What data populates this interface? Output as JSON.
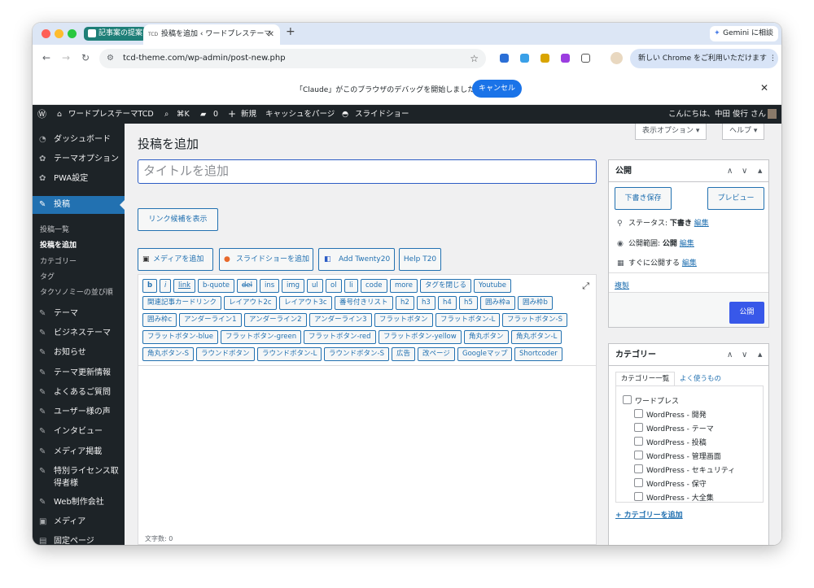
{
  "browser": {
    "tab_group_label": "記事案の提案",
    "active_tab_favicon": "TCD",
    "active_tab_title": "投稿を追加 ‹ ワードプレステーマ",
    "new_tab": "+",
    "gemini_label": "Gemini に相談",
    "url": "tcd-theme.com/wp-admin/post-new.php",
    "chrome_update": "新しい Chrome をご利用いただけます ⋮",
    "debug_message": "「Claude」がこのブラウザのデバッグを開始しました",
    "debug_cancel": "キャンセル",
    "close": "✕"
  },
  "adminbar": {
    "site_name": "ワードプレステーマTCD",
    "search_shortcut": "⌘K",
    "comments_count": "0",
    "new_label": "新規",
    "cache_purge": "キャッシュをパージ",
    "slideshow": "スライドショー",
    "greeting": "こんにちは、中田 俊行 さん"
  },
  "sidebar": {
    "menu": [
      {
        "label": "ダッシュボード",
        "icon": "gauge-icon"
      },
      {
        "label": "テーマオプション",
        "icon": "gear-icon"
      },
      {
        "label": "PWA設定",
        "icon": "gear-icon"
      },
      {
        "label": "投稿",
        "icon": "pin-icon"
      }
    ],
    "submenu": [
      "投稿一覧",
      "投稿を追加",
      "カテゴリー",
      "タグ",
      "タクソノミーの並び順"
    ],
    "menu2": [
      {
        "label": "テーマ",
        "icon": "pin-icon"
      },
      {
        "label": "ビジネステーマ",
        "icon": "pin-icon"
      },
      {
        "label": "お知らせ",
        "icon": "pin-icon"
      },
      {
        "label": "テーマ更新情報",
        "icon": "pin-icon"
      },
      {
        "label": "よくあるご質問",
        "icon": "pin-icon"
      },
      {
        "label": "ユーザー様の声",
        "icon": "pin-icon"
      },
      {
        "label": "インタビュー",
        "icon": "pin-icon"
      },
      {
        "label": "メディア掲載",
        "icon": "pin-icon"
      },
      {
        "label": "特別ライセンス取",
        "icon": "pin-icon"
      },
      {
        "label": "得者様",
        "icon": ""
      },
      {
        "label": "Web制作会社",
        "icon": "pin-icon"
      },
      {
        "label": "メディア",
        "icon": "media-icon"
      },
      {
        "label": "固定ページ",
        "icon": "page-icon"
      }
    ]
  },
  "main": {
    "screen_options": "表示オプション ▾",
    "help": "ヘルプ ▾",
    "page_title": "投稿を追加",
    "title_placeholder": "タイトルを追加",
    "link_suggest": "リンク候補を表示",
    "media_buttons": [
      "メディアを追加",
      "スライドショーを追加",
      "Add Twenty20",
      "Help T20"
    ],
    "quicktags": [
      [
        "b",
        "i",
        "link",
        "b-quote",
        "del",
        "ins",
        "img",
        "ul",
        "ol",
        "li",
        "code",
        "more",
        "タグを閉じる",
        "Youtube"
      ],
      [
        "関連記事カードリンク",
        "レイアウト2c",
        "レイアウト3c",
        "番号付きリスト",
        "h2",
        "h3",
        "h4",
        "h5",
        "囲み枠a",
        "囲み枠b"
      ],
      [
        "囲み枠c",
        "アンダーライン1",
        "アンダーライン2",
        "アンダーライン3",
        "フラットボタン",
        "フラットボタン-L",
        "フラットボタン-S"
      ],
      [
        "フラットボタン-blue",
        "フラットボタン-green",
        "フラットボタン-red",
        "フラットボタン-yellow",
        "角丸ボタン",
        "角丸ボタン-L"
      ],
      [
        "角丸ボタン-S",
        "ラウンドボタン",
        "ラウンドボタン-L",
        "ラウンドボタン-S",
        "広告",
        "改ページ",
        "Googleマップ",
        "Shortcoder"
      ]
    ],
    "word_count": "文字数: 0"
  },
  "publish": {
    "title": "公開",
    "save_draft": "下書き保存",
    "preview": "プレビュー",
    "status_label": "ステータス: ",
    "status_value": "下書き",
    "visibility_label": "公開範囲: ",
    "visibility_value": "公開",
    "schedule_label": "すぐに公開する",
    "edit": "編集",
    "copy": "複製",
    "publish_btn": "公開"
  },
  "category": {
    "title": "カテゴリー",
    "tab_all": "カテゴリー一覧",
    "tab_popular": "よく使うもの",
    "items": [
      "ワードプレス",
      "WordPress - 開発",
      "WordPress - テーマ",
      "WordPress - 投稿",
      "WordPress - 管理画面",
      "WordPress - セキュリティ",
      "WordPress - 保守",
      "WordPress - 大全集"
    ],
    "add_new": "+ カテゴリーを追加"
  },
  "colors": {
    "admin_dark": "#1d2327",
    "wp_blue": "#2271b1",
    "publish_blue": "#3858e9",
    "chrome_blue": "#1a73e8"
  }
}
